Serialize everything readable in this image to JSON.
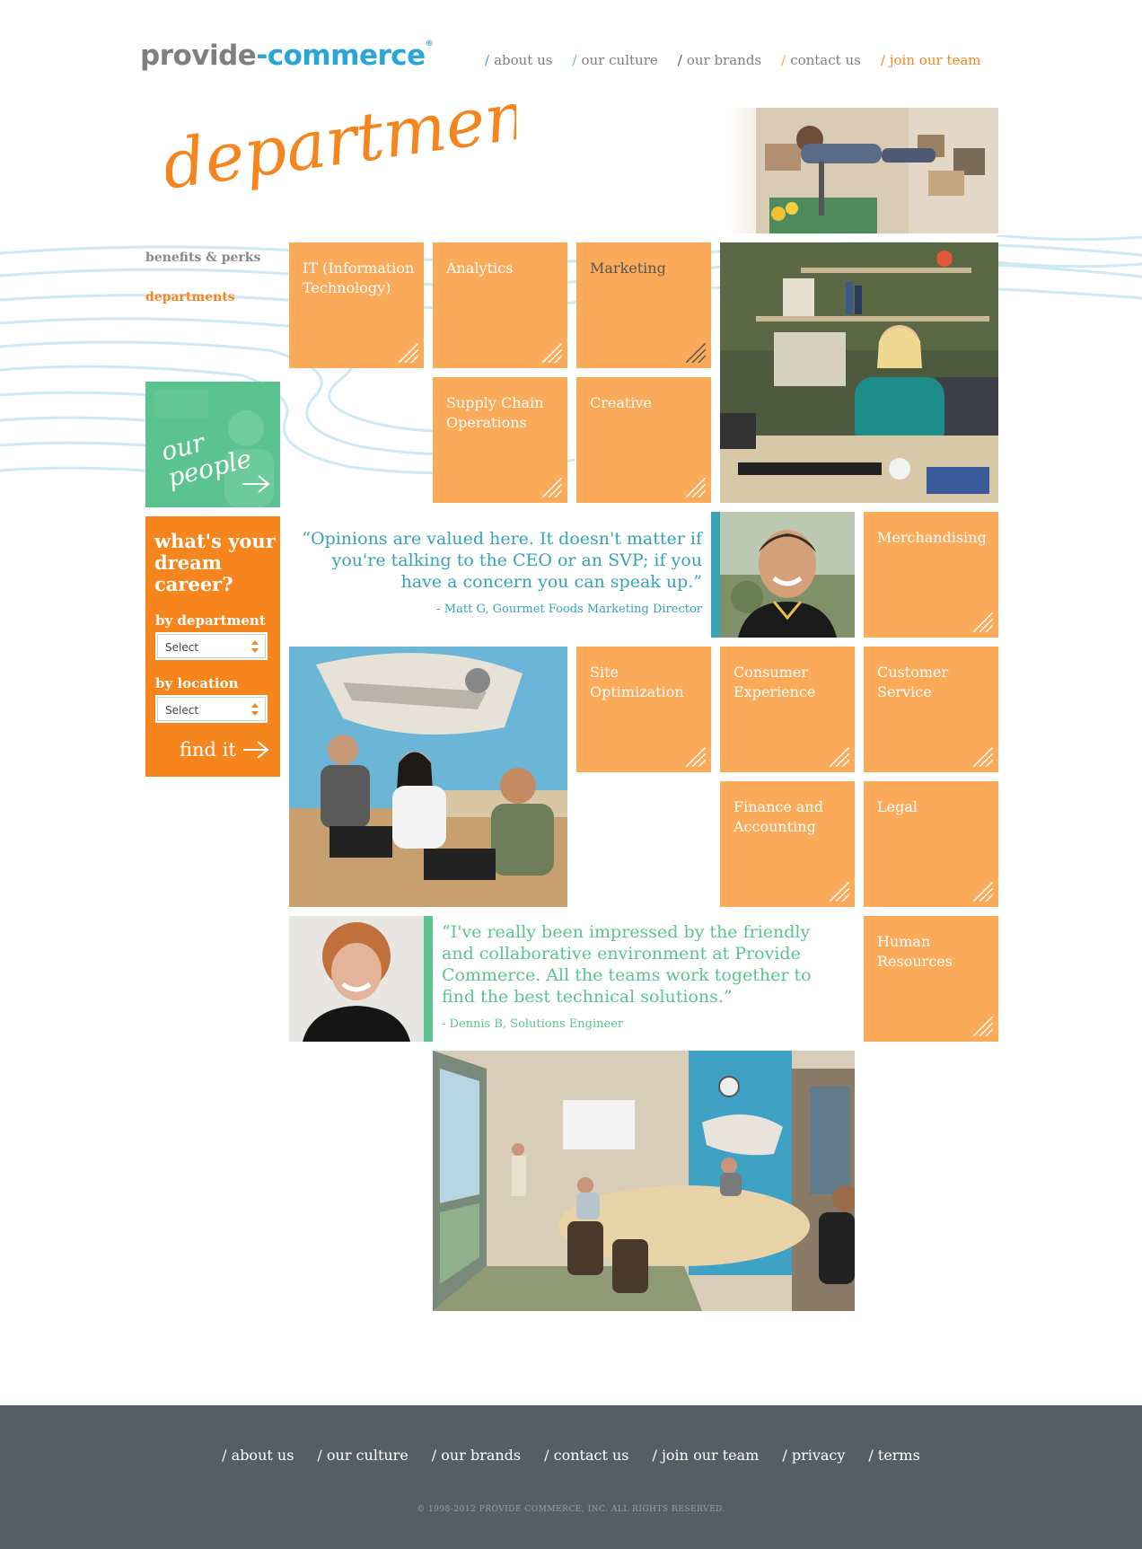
{
  "brand": {
    "logo_part1": "provide",
    "logo_part2": "-commerce",
    "reg": "®"
  },
  "top_nav": [
    {
      "label": "about us"
    },
    {
      "label": "our culture"
    },
    {
      "label": "our brands"
    },
    {
      "label": "contact us"
    },
    {
      "label": "join our team"
    }
  ],
  "page_title": "departments",
  "sidebar": {
    "links": [
      {
        "label": "benefits & perks"
      },
      {
        "label": "departments"
      }
    ],
    "our_people": "our people"
  },
  "career": {
    "heading": "what's your dream career?",
    "by_department": "by department",
    "by_location": "by location",
    "department_select": "Select",
    "location_select": "Select",
    "find": "find it"
  },
  "departments": [
    "IT (Information Technology)",
    "Analytics",
    "Marketing",
    "Supply Chain Operations",
    "Creative",
    "Merchandising",
    "Site Optimization",
    "Consumer Experience",
    "Customer Service",
    "Finance and Accounting",
    "Legal",
    "Human Resources"
  ],
  "quotes": [
    {
      "text": "“Opinions are valued here. It doesn't matter if you're talking to the CEO or an SVP; if you have a concern you can speak up.”",
      "attribution": "- Matt G, Gourmet Foods Marketing Director"
    },
    {
      "text": "“I've really been impressed by the friendly and collaborative environment at Provide Commerce. All the teams work together to find the best technical solutions.”",
      "attribution": "- Dennis B, Solutions Engineer"
    }
  ],
  "footer": {
    "links": [
      {
        "label": "/ about us"
      },
      {
        "label": "/ our culture"
      },
      {
        "label": "/ our brands"
      },
      {
        "label": "/ contact us"
      },
      {
        "label": "/ join our team"
      },
      {
        "label": "/ privacy"
      },
      {
        "label": "/ terms"
      }
    ],
    "copyright": "© 1998-2012 PROVIDE COMMERCE, INC. ALL RIGHTS RESERVED."
  },
  "colors": {
    "tile": "#fbaa59",
    "accent_orange": "#f7851e",
    "accent_teal": "#36a4b5",
    "accent_green": "#5bc38f",
    "brand_blue": "#28a6d8",
    "footer_bg": "#555d67"
  },
  "icons": [
    "arrow-right-icon",
    "corner-stripes-icon",
    "select-arrows-icon"
  ]
}
